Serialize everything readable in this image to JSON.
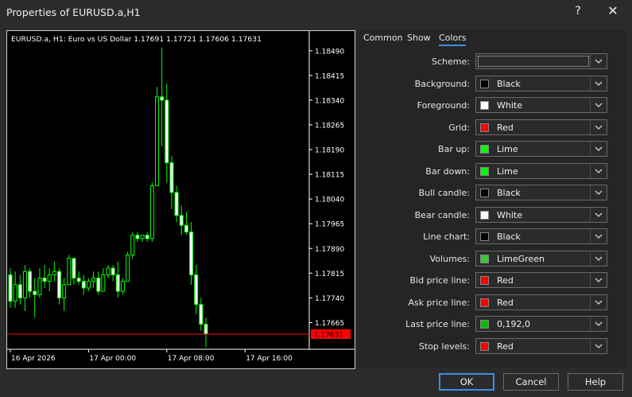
{
  "window": {
    "title": "Properties of EURUSD.a,H1",
    "help_glyph": "?",
    "close_glyph": "✕"
  },
  "chart": {
    "info_text": "EURUSD.a, H1:  Euro vs US Dollar  1.17691 1.17721 1.17606 1.17631",
    "current_price_label": "1.17631",
    "price_line_color": "#ff0000",
    "colors": {
      "background": "#000000",
      "foreground": "#ffffff",
      "bar_up": "#00ff00",
      "bar_down": "#00ff00",
      "bull_candle": "#000000",
      "bear_candle": "#ffffff"
    }
  },
  "chart_data": {
    "type": "candlestick",
    "title": "EURUSD.a, H1:  Euro vs US Dollar  1.17691 1.17721 1.17606 1.17631",
    "xlabel": "",
    "ylabel": "",
    "ylim": [
      1.17584,
      1.18545
    ],
    "grid": false,
    "y_ticks": [
      1.1849,
      1.18415,
      1.1834,
      1.18265,
      1.1819,
      1.18115,
      1.1804,
      1.17965,
      1.1789,
      1.17815,
      1.1774,
      1.17665
    ],
    "y_tick_labels": [
      "1.18490",
      "1.18415",
      "1.18340",
      "1.18265",
      "1.18190",
      "1.18115",
      "1.18040",
      "1.17965",
      "1.17890",
      "1.17815",
      "1.17740",
      "1.17665"
    ],
    "x_tick_labels": [
      "16 Apr 2026",
      "17 Apr 00:00",
      "17 Apr 08:00",
      "17 Apr 16:00"
    ],
    "x_tick_index": [
      0,
      16,
      32,
      48
    ],
    "candles": [
      {
        "o": 1.1781,
        "h": 1.1783,
        "l": 1.1771,
        "c": 1.1773
      },
      {
        "o": 1.1773,
        "h": 1.1782,
        "l": 1.1771,
        "c": 1.1778
      },
      {
        "o": 1.1778,
        "h": 1.1781,
        "l": 1.1772,
        "c": 1.1774
      },
      {
        "o": 1.1774,
        "h": 1.1784,
        "l": 1.177,
        "c": 1.1782
      },
      {
        "o": 1.1782,
        "h": 1.1783,
        "l": 1.1774,
        "c": 1.1776
      },
      {
        "o": 1.1776,
        "h": 1.178,
        "l": 1.1768,
        "c": 1.1775
      },
      {
        "o": 1.1775,
        "h": 1.1783,
        "l": 1.1774,
        "c": 1.178
      },
      {
        "o": 1.178,
        "h": 1.1784,
        "l": 1.1777,
        "c": 1.1779
      },
      {
        "o": 1.1779,
        "h": 1.1783,
        "l": 1.1776,
        "c": 1.1781
      },
      {
        "o": 1.1781,
        "h": 1.1785,
        "l": 1.1779,
        "c": 1.1782
      },
      {
        "o": 1.1782,
        "h": 1.1783,
        "l": 1.1772,
        "c": 1.1774
      },
      {
        "o": 1.1774,
        "h": 1.178,
        "l": 1.177,
        "c": 1.1778
      },
      {
        "o": 1.1778,
        "h": 1.1787,
        "l": 1.1778,
        "c": 1.1786
      },
      {
        "o": 1.1786,
        "h": 1.1786,
        "l": 1.1778,
        "c": 1.178
      },
      {
        "o": 1.178,
        "h": 1.1782,
        "l": 1.1778,
        "c": 1.1779
      },
      {
        "o": 1.1779,
        "h": 1.1781,
        "l": 1.1775,
        "c": 1.1777
      },
      {
        "o": 1.1777,
        "h": 1.178,
        "l": 1.1776,
        "c": 1.1779
      },
      {
        "o": 1.1779,
        "h": 1.1782,
        "l": 1.1777,
        "c": 1.178
      },
      {
        "o": 1.178,
        "h": 1.1782,
        "l": 1.1775,
        "c": 1.1776
      },
      {
        "o": 1.1776,
        "h": 1.1783,
        "l": 1.1776,
        "c": 1.1781
      },
      {
        "o": 1.1781,
        "h": 1.1784,
        "l": 1.178,
        "c": 1.1783
      },
      {
        "o": 1.1783,
        "h": 1.1784,
        "l": 1.1779,
        "c": 1.1781
      },
      {
        "o": 1.1781,
        "h": 1.1785,
        "l": 1.1774,
        "c": 1.1776
      },
      {
        "o": 1.1776,
        "h": 1.178,
        "l": 1.1775,
        "c": 1.1779
      },
      {
        "o": 1.1779,
        "h": 1.1788,
        "l": 1.1779,
        "c": 1.1787
      },
      {
        "o": 1.1787,
        "h": 1.1794,
        "l": 1.1786,
        "c": 1.1793
      },
      {
        "o": 1.1793,
        "h": 1.1794,
        "l": 1.1791,
        "c": 1.1792
      },
      {
        "o": 1.1792,
        "h": 1.1793,
        "l": 1.1791,
        "c": 1.1793
      },
      {
        "o": 1.1793,
        "h": 1.1794,
        "l": 1.1791,
        "c": 1.1792
      },
      {
        "o": 1.1792,
        "h": 1.1809,
        "l": 1.1791,
        "c": 1.1808
      },
      {
        "o": 1.1808,
        "h": 1.1838,
        "l": 1.1808,
        "c": 1.1835
      },
      {
        "o": 1.1835,
        "h": 1.185,
        "l": 1.182,
        "c": 1.1834
      },
      {
        "o": 1.1834,
        "h": 1.1839,
        "l": 1.1809,
        "c": 1.1815
      },
      {
        "o": 1.1815,
        "h": 1.1817,
        "l": 1.1801,
        "c": 1.1806
      },
      {
        "o": 1.1806,
        "h": 1.1808,
        "l": 1.1797,
        "c": 1.1799
      },
      {
        "o": 1.1799,
        "h": 1.1802,
        "l": 1.1793,
        "c": 1.1796
      },
      {
        "o": 1.1796,
        "h": 1.18,
        "l": 1.1793,
        "c": 1.1794
      },
      {
        "o": 1.1794,
        "h": 1.1797,
        "l": 1.1778,
        "c": 1.1781
      },
      {
        "o": 1.1781,
        "h": 1.1784,
        "l": 1.1769,
        "c": 1.1772
      },
      {
        "o": 1.1772,
        "h": 1.1774,
        "l": 1.1764,
        "c": 1.1766
      },
      {
        "o": 1.1766,
        "h": 1.1768,
        "l": 1.1759,
        "c": 1.1763
      }
    ]
  },
  "tabs": [
    "Common",
    "Show",
    "Colors"
  ],
  "active_tab": 2,
  "settings": [
    {
      "label": "Scheme:",
      "value": "",
      "color": "",
      "scheme": true
    },
    {
      "label": "Background:",
      "value": "Black",
      "color": "#000000"
    },
    {
      "label": "Foreground:",
      "value": "White",
      "color": "#ffffff"
    },
    {
      "label": "Grid:",
      "value": "Red",
      "color": "#ff0000"
    },
    {
      "label": "Bar up:",
      "value": "Lime",
      "color": "#00ff00"
    },
    {
      "label": "Bar down:",
      "value": "Lime",
      "color": "#00ff00"
    },
    {
      "label": "Bull candle:",
      "value": "Black",
      "color": "#000000"
    },
    {
      "label": "Bear candle:",
      "value": "White",
      "color": "#ffffff"
    },
    {
      "label": "Line chart:",
      "value": "Black",
      "color": "#000000"
    },
    {
      "label": "Volumes:",
      "value": "LimeGreen",
      "color": "#32cd32"
    },
    {
      "label": "Bid price line:",
      "value": "Red",
      "color": "#ff0000"
    },
    {
      "label": "Ask price line:",
      "value": "Red",
      "color": "#ff0000"
    },
    {
      "label": "Last price line:",
      "value": "0,192,0",
      "color": "#00c000"
    },
    {
      "label": "Stop levels:",
      "value": "Red",
      "color": "#ff0000"
    }
  ],
  "buttons": {
    "ok": "OK",
    "cancel": "Cancel",
    "help": "Help"
  }
}
